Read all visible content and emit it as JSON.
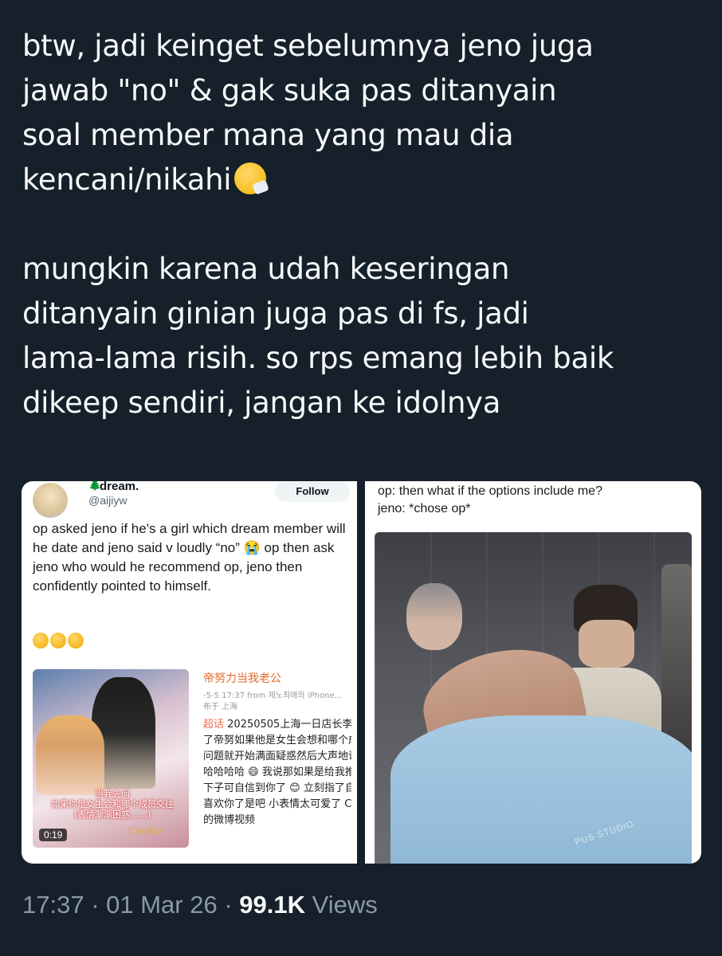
{
  "tweet": {
    "paragraph1": "btw, jadi keinget sebelumnya jeno juga\njawab \"no\" & gak suka pas ditanyain\nsoal member mana yang mau dia\nkencani/nikahi",
    "paragraph2": "mungkin karena udah keseringan\nditanyain ginian juga pas di fs, jadi\nlama-lama risih. so rps emang lebih baik\ndikeep sendiri, jangan ke idolnya"
  },
  "embedded_left": {
    "name": "dream.",
    "handle": "@aijiyw",
    "follow_label": "Follow",
    "text": "op asked jeno if he's a girl which dream member will he date and jeno said v loudly “no” 😭 op then ask jeno who would he recommend op, jeno then confidently pointed to himself.",
    "video": {
      "caption": "当我先问\n如果你是女生会和哪个成员交往\n(表情渐渐困惑……)",
      "signature": "Cecilia",
      "duration": "0:19"
    },
    "weibo": {
      "title": "帝努力当我老公",
      "meta": "-5-5 17:37  from 제노최애의 iPhone...",
      "location": "布于 上海",
      "body_topic": "超话",
      "body": " 20250505上海一日店长李\n了帝努如果他是女生会想和哪个成\n问题就开始满面疑惑然后大声地说\n哈哈哈哈 😄 我说那如果是给我推\n下子可自信到你了 😊 立刻指了自\n喜欢你了是吧 小表情太可爱了 C\n的微博视频"
    }
  },
  "embedded_right": {
    "text": "op: then what if the options include me?\njeno: *chose op*",
    "watermark": "PUS STUDIO"
  },
  "meta": {
    "time": "17:37",
    "date": "01 Mar 26",
    "views_count": "99.1K",
    "views_label": "Views"
  }
}
